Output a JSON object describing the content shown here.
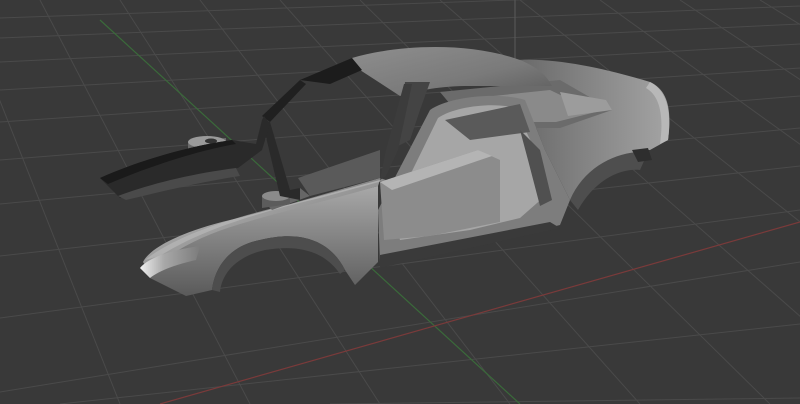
{
  "viewport": {
    "view": "perspective",
    "colors": {
      "background": "#393939",
      "grid_line": "#4a4a4a",
      "x_axis": "#7a3a3a",
      "y_axis": "#3a6a3a",
      "z_axis": "#5a5a5a"
    },
    "object": {
      "kind": "car-body-shell",
      "shading": "gray-solid",
      "parts": [
        "roof",
        "hood",
        "front-fender",
        "rear-quarter-panel",
        "door-frame",
        "windshield-frame",
        "rear-window-frame",
        "front-bumper",
        "interior-floor",
        "strut-tower-mount"
      ]
    }
  }
}
